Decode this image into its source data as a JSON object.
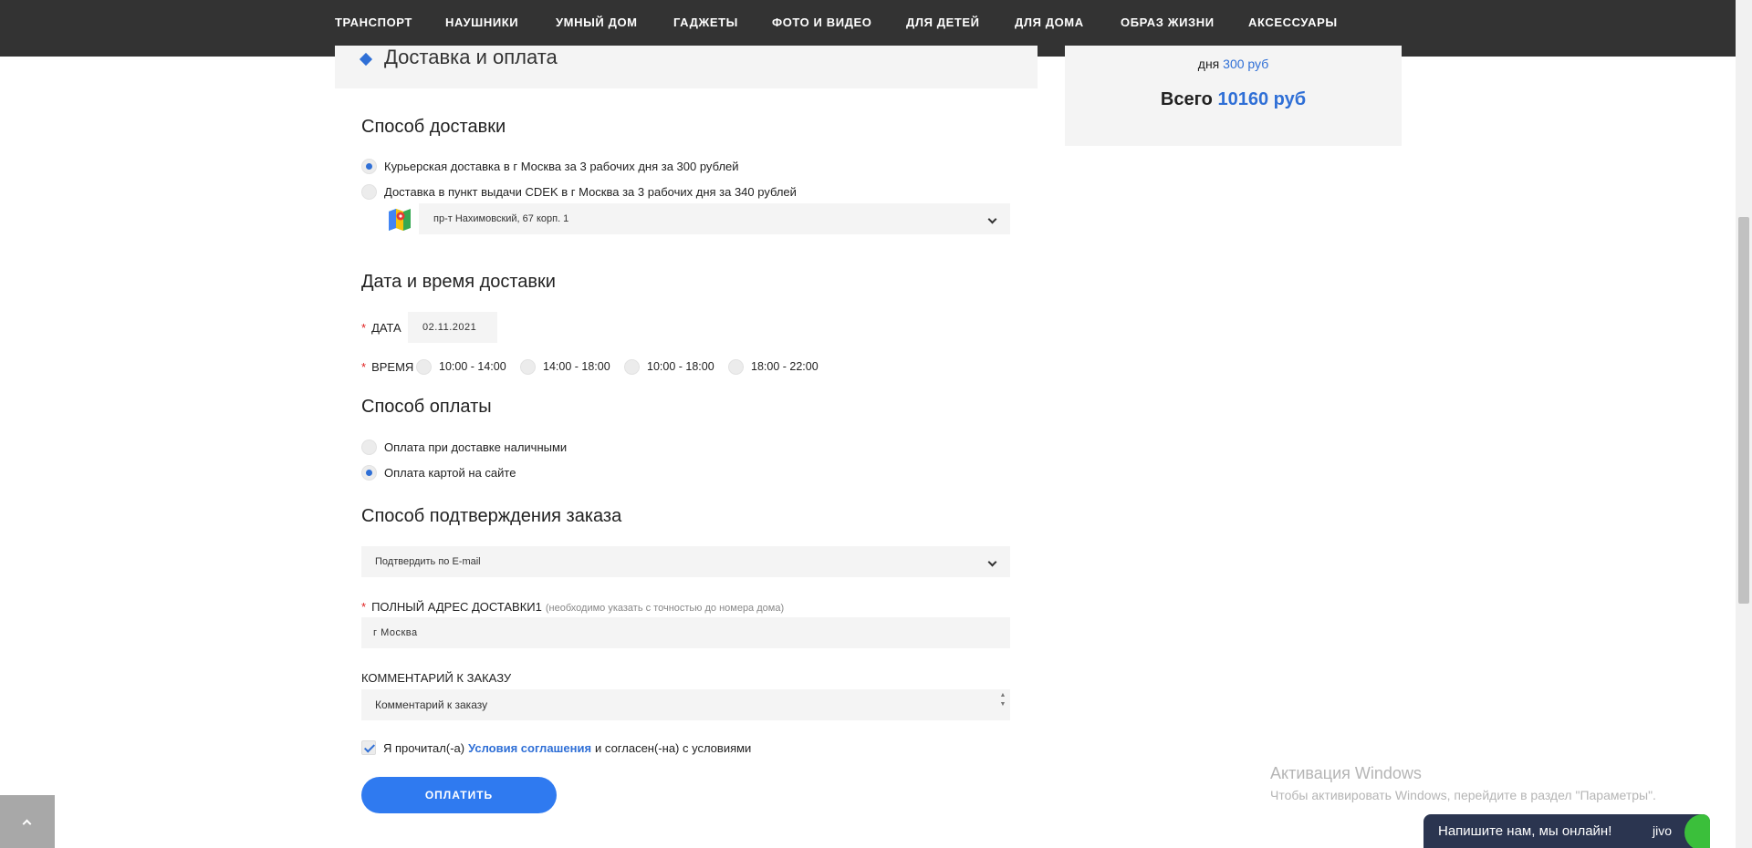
{
  "nav": {
    "items": [
      "ТРАНСПОРТ",
      "НАУШНИКИ",
      "УМНЫЙ ДОМ",
      "ГАДЖЕТЫ",
      "ФОТО И ВИДЕО",
      "ДЛЯ ДЕТЕЙ",
      "ДЛЯ ДОМА",
      "ОБРАЗ ЖИЗНИ",
      "АКСЕССУАРЫ"
    ]
  },
  "section_header": {
    "title": "Доставка и оплата"
  },
  "summary": {
    "days_prefix": "дня",
    "delivery_cost": "300 руб",
    "total_label": "Всего",
    "total_value": "10160 руб"
  },
  "delivery": {
    "title": "Способ доставки",
    "options": [
      {
        "label": "Курьерская доставка в г Москва за 3 рабочих дня за 300 рублей",
        "selected": true
      },
      {
        "label": "Доставка в пункт выдачи CDEK в г Москва за 3 рабочих дня за 340 рублей",
        "selected": false
      }
    ],
    "pickup_point": "пр-т Нахимовский, 67 корп. 1"
  },
  "datetime": {
    "title": "Дата и время доставки",
    "date_label": "ДАТА",
    "date_value": "02.11.2021",
    "time_label": "ВРЕМЯ",
    "time_slots": [
      "10:00 - 14:00",
      "14:00 - 18:00",
      "10:00 - 18:00",
      "18:00 - 22:00"
    ]
  },
  "payment": {
    "title": "Способ оплаты",
    "options": [
      {
        "label": "Оплата при доставке наличными",
        "selected": false
      },
      {
        "label": "Оплата картой на сайте",
        "selected": true
      }
    ]
  },
  "confirmation": {
    "title": "Способ подтверждения заказа",
    "selected": "Подтвердить по E-mail"
  },
  "address": {
    "label": "ПОЛНЫЙ АДРЕС ДОСТАВКИ1",
    "hint": "(необходимо указать с точностью до номера дома)",
    "value": "г Москва"
  },
  "comment": {
    "label": "КОММЕНТАРИЙ К ЗАКАЗУ",
    "placeholder": "Комментарий к заказу"
  },
  "agreement": {
    "prefix": "Я прочитал(-а)",
    "link": "Условия соглашения",
    "suffix": "и согласен(-на) с условиями"
  },
  "pay_button": "ОПЛАТИТЬ",
  "windows": {
    "title": "Активация Windows",
    "subtitle": "Чтобы активировать Windows, перейдите в раздел \"Параметры\"."
  },
  "chat": {
    "text": "Напишите нам, мы онлайн!",
    "brand": "jivo"
  },
  "colors": {
    "accent": "#2f6fd6",
    "button": "#2f7af0",
    "nav_bg": "#333333",
    "panel_bg": "#f4f4f4",
    "required": "#e02020"
  }
}
